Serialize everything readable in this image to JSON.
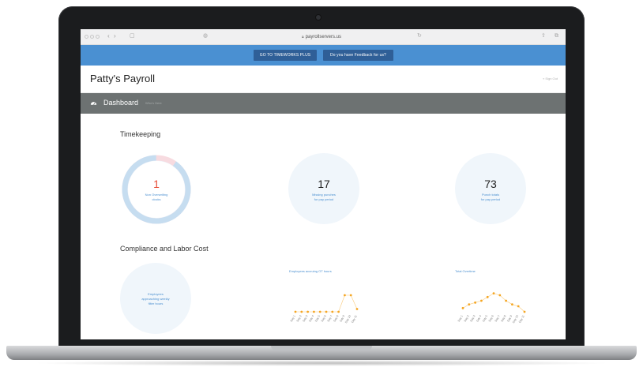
{
  "browser": {
    "url": "payrollservers.us"
  },
  "banner": {
    "primary_button": "GO TO TIMEWORKS PLUS",
    "feedback_button": "Do you have Feedback for us?"
  },
  "app": {
    "title": "Patty's Payroll",
    "sign_out": "« Sign Out"
  },
  "dashboard": {
    "title": "Dashboard",
    "subtitle": "Who's Here"
  },
  "timekeeping": {
    "section_title": "Timekeeping",
    "cards": [
      {
        "value": "1",
        "caption_line1": "Non Overwriting",
        "caption_line2": "clocks",
        "value_color": "#e8503a"
      },
      {
        "value": "17",
        "caption_line1": "Missing punches",
        "caption_line2": "for pay period",
        "value_color": "#222222"
      },
      {
        "value": "73",
        "caption_line1": "Punch totals",
        "caption_line2": "for pay period",
        "value_color": "#222222"
      }
    ],
    "donut_ratio": 0.9
  },
  "compliance": {
    "section_title": "Compliance and Labor Cost",
    "card": {
      "caption_line1": "Employees",
      "caption_line2": "approaching weekly",
      "caption_line3": "filter hours"
    }
  },
  "chart_data": [
    {
      "type": "line",
      "title": "Employees accruing OT hours",
      "x": [
        "Day 1",
        "Day 2",
        "Day 3",
        "Day 4",
        "Day 5",
        "Day 6",
        "Day 7",
        "Day 8",
        "Day 9",
        "Day 10",
        "Day 11"
      ],
      "series": [
        {
          "values": [
            0,
            0,
            0,
            0,
            0,
            0,
            0,
            0,
            6,
            6,
            1
          ]
        }
      ],
      "ylim": [
        0,
        8
      ],
      "color": "#f5a623"
    },
    {
      "type": "line",
      "title": "Total Overtime",
      "x": [
        "Day 1",
        "Day 2",
        "Day 3",
        "Day 4",
        "Day 5",
        "Day 6",
        "Day 7",
        "Day 8",
        "Day 9",
        "Day 10",
        "Day 11"
      ],
      "series": [
        {
          "values": [
            1,
            2,
            2.5,
            3,
            4,
            5,
            4.5,
            3,
            2,
            1.5,
            0
          ]
        }
      ],
      "ylim": [
        0,
        6
      ],
      "color": "#f5a623"
    }
  ],
  "colors": {
    "banner": "#4a90d2",
    "banner_button": "#2f5f97",
    "dash_bar": "#6d7272",
    "accent": "#4a8fd0",
    "donut": "#c6ddf0",
    "donut_alert": "#f7dbe0",
    "chart_marker": "#f5a623"
  }
}
